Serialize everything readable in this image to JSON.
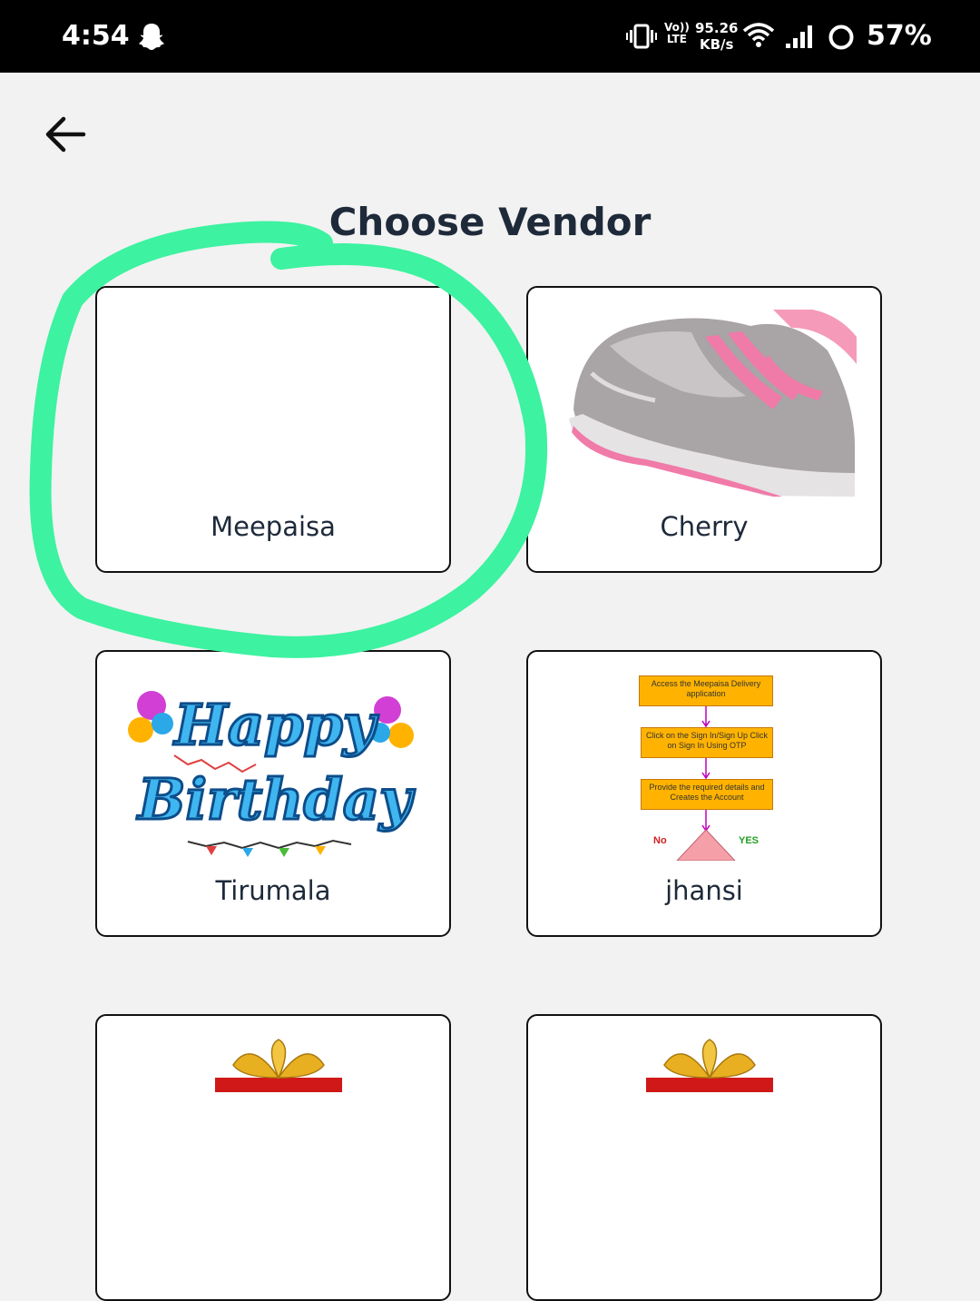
{
  "status_bar": {
    "time": "4:54",
    "network_line1": "Vo))",
    "network_line2": "LTE",
    "speed_value": "95.26",
    "speed_unit": "KB/s",
    "battery": "57%"
  },
  "header": {
    "title": "Choose Vendor"
  },
  "vendors": [
    {
      "name": "Meepaisa",
      "image": "none"
    },
    {
      "name": "Cherry",
      "image": "pink-sneaker"
    },
    {
      "name": "Tirumala",
      "image": "happy-birthday-banner"
    },
    {
      "name": "jhansi",
      "image": "flowchart"
    },
    {
      "name": "",
      "image": "gift-bow"
    },
    {
      "name": "",
      "image": "gift-bow"
    }
  ],
  "birthday_image": {
    "line1": "Happy",
    "line2": "Birthday"
  },
  "flowchart": {
    "step1": "Access the Meepaisa Delivery application",
    "step2": "Click on the Sign In/Sign Up Click on Sign In Using OTP",
    "step3": "Provide the required details and Creates the Account",
    "no_label": "No",
    "yes_label": "YES"
  },
  "annotation": {
    "color": "#3df2a0"
  }
}
